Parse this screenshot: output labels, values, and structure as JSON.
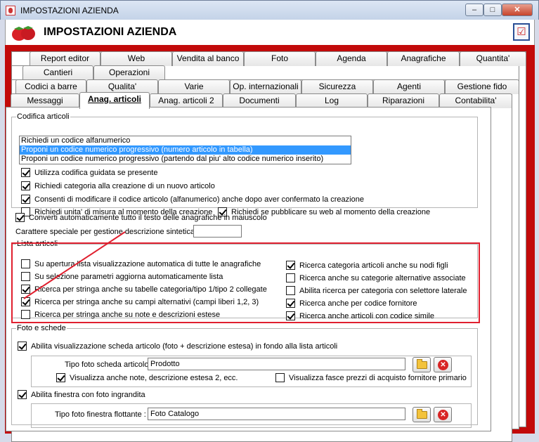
{
  "window": {
    "title": "IMPOSTAZIONI AZIENDA",
    "min_label": "–",
    "max_label": "□",
    "close_label": "✕"
  },
  "header": {
    "title": "IMPOSTAZIONI AZIENDA",
    "logo_icon": "strawberry-icon",
    "action_icon": "checklist-icon"
  },
  "tabs": {
    "row1": [
      "Report editor",
      "Web",
      "Vendita al banco",
      "Foto",
      "Agenda",
      "Anagrafiche",
      "Quantita'"
    ],
    "row2": [
      "Cantieri",
      "Operazioni"
    ],
    "row3": [
      "Codici a barre",
      "Qualita'",
      "Varie",
      "Op. internazionali",
      "Sicurezza",
      "Agenti",
      "Gestione fido"
    ],
    "row4": [
      "Messaggi",
      "Anag. articoli",
      "Anag. articoli 2",
      "Documenti",
      "Log",
      "Riparazioni",
      "Contabilita'"
    ],
    "active": "Anag. articoli"
  },
  "codifica": {
    "legend": "Codifica articoli",
    "options": [
      "Richiedi un codice alfanumerico",
      "Proponi un codice numerico progressivo (numero articolo in tabella)",
      "Proponi un codice numerico progressivo (partendo dal piu' alto codice numerico inserito)"
    ],
    "selected_index": 1,
    "checks": [
      {
        "label": "Utilizza codifica guidata se presente",
        "checked": true
      },
      {
        "label": "Richiedi categoria alla creazione di un nuovo articolo",
        "checked": true
      },
      {
        "label": "Consenti di modificare il codice articolo (alfanumerico) anche dopo aver confermato la creazione",
        "checked": true
      },
      {
        "label": "Richiedi unita' di misura al momento della creazione",
        "checked": false
      },
      {
        "label": "Richiedi se pubblicare su web al momento della creazione",
        "checked": true
      }
    ]
  },
  "converti": {
    "label": "Converti automaticamente tutto il testo delle anagrafiche in maiuscolo",
    "checked": true
  },
  "carattere": {
    "label": "Carattere speciale per gestione descrizione sintetica :",
    "value": ""
  },
  "lista": {
    "legend": "Lista articoli",
    "left": [
      {
        "label": "Su apertura lista visualizzazione automatica di tutte le anagrafiche",
        "checked": false
      },
      {
        "label": "Su selezione parametri aggiorna automaticamente lista",
        "checked": false
      },
      {
        "label": "Ricerca per stringa anche su tabelle categoria/tipo 1/tipo 2 collegate",
        "checked": true
      },
      {
        "label": "Ricerca per stringa anche su campi alternativi (campi liberi 1,2, 3)",
        "checked": true
      },
      {
        "label": "Ricerca per stringa anche su note e descrizioni estese",
        "checked": false
      }
    ],
    "right": [
      {
        "label": "Ricerca categoria articoli anche su nodi figli",
        "checked": true
      },
      {
        "label": "Ricerca anche su categorie alternative associate",
        "checked": false
      },
      {
        "label": "Abilita ricerca per categoria con selettore laterale",
        "checked": false
      },
      {
        "label": "Ricerca anche per codice fornitore",
        "checked": true
      },
      {
        "label": "Ricerca anche articoli con codice simile",
        "checked": true
      }
    ]
  },
  "foto": {
    "legend": "Foto e schede",
    "abilita_scheda": {
      "label": "Abilita visualizzazione scheda articolo (foto + descrizione estesa) in fondo alla lista articoli",
      "checked": true
    },
    "tipo_scheda_label": "Tipo foto scheda articolo :",
    "tipo_scheda_value": "Prodotto",
    "visualizza_note": {
      "label": "Visualizza anche note, descrizione estesa 2, ecc.",
      "checked": true
    },
    "visualizza_fasce": {
      "label": "Visualizza fasce prezzi di acquisto fornitore primario",
      "checked": false
    },
    "abilita_finestra": {
      "label": "Abilita finestra con foto ingrandita",
      "checked": true
    },
    "tipo_finestra_label": "Tipo foto finestra flottante :",
    "tipo_finestra_value": "Foto Catalogo",
    "folder_icon": "folder-icon",
    "delete_icon": "delete-icon"
  },
  "colors": {
    "frame": "#c20a0a",
    "highlight": "#e0202f",
    "selection": "#3399ff"
  }
}
